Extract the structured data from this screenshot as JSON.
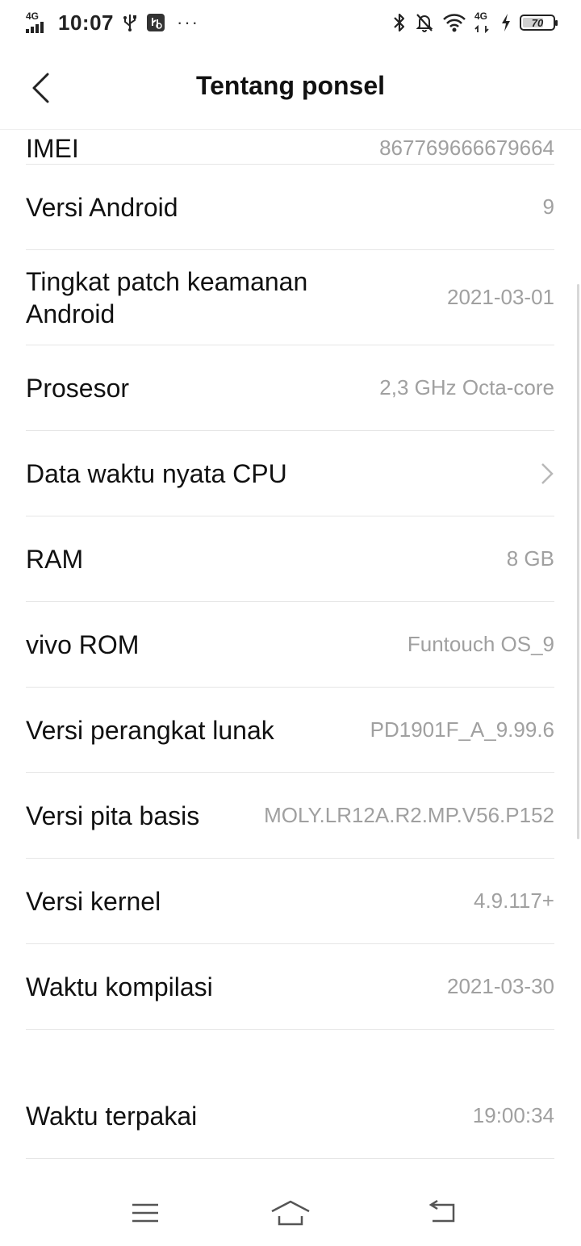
{
  "status_bar": {
    "network_tag": "4G",
    "time": "10:07",
    "more_dots": "···",
    "right_network_tag": "4G",
    "battery_level": "70",
    "battery_fraction": 0.7
  },
  "header": {
    "title": "Tentang ponsel"
  },
  "partial_row": {
    "label": "IMEI",
    "value": "867769666679664"
  },
  "rows": [
    {
      "label": "Versi Android",
      "value": "9"
    },
    {
      "label": "Tingkat patch keamanan Android",
      "value": "2021-03-01"
    },
    {
      "label": "Prosesor",
      "value": "2,3 GHz Octa-core"
    },
    {
      "label": "Data waktu nyata CPU",
      "value": ""
    },
    {
      "label": "RAM",
      "value": "8 GB"
    },
    {
      "label": "vivo ROM",
      "value": "Funtouch OS_9"
    },
    {
      "label": "Versi perangkat lunak",
      "value": "PD1901F_A_9.99.6"
    },
    {
      "label": "Versi pita basis",
      "value": "MOLY.LR12A.R2.MP.V56.P152"
    },
    {
      "label": "Versi kernel",
      "value": "4.9.117+"
    },
    {
      "label": "Waktu kompilasi",
      "value": "2021-03-30"
    },
    {
      "label": "Waktu terpakai",
      "value": "19:00:34"
    }
  ],
  "icons": {
    "back": "back-chevron-icon",
    "chevron": "chevron-right-icon",
    "menu": "menu-icon",
    "home": "home-icon",
    "back_nav": "return-icon"
  }
}
